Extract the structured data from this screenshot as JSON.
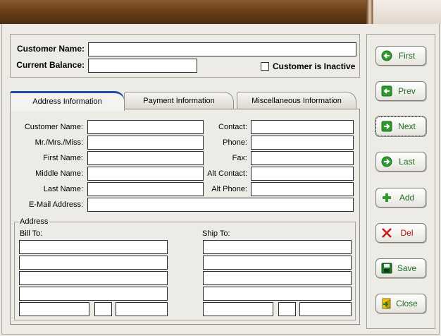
{
  "header": {
    "customer_name_label": "Customer Name:",
    "current_balance_label": "Current Balance:",
    "inactive_label": "Customer is Inactive",
    "customer_name_value": "",
    "current_balance_value": "",
    "inactive_checked": false
  },
  "tabs": [
    {
      "label": "Address Information",
      "active": true
    },
    {
      "label": "Payment Information",
      "active": false
    },
    {
      "label": "Miscellaneous Information",
      "active": false
    }
  ],
  "address_tab": {
    "left_labels": [
      "Customer Name:",
      "Mr./Mrs./Miss:",
      "First Name:",
      "Middle Name:",
      "Last Name:"
    ],
    "right_labels": [
      "Contact:",
      "Phone:",
      "Fax:",
      "Alt Contact:",
      "Alt Phone:"
    ],
    "email_label": "E-Mail Address:",
    "address_group_label": "Address",
    "bill_to_label": "Bill To:",
    "ship_to_label": "Ship To:"
  },
  "buttons": [
    {
      "label": "First",
      "icon": "arrow-left-circle-icon"
    },
    {
      "label": "Prev",
      "icon": "arrow-left-square-icon"
    },
    {
      "label": "Next",
      "icon": "arrow-right-square-icon"
    },
    {
      "label": "Last",
      "icon": "arrow-right-circle-icon"
    },
    {
      "label": "Add",
      "icon": "plus-icon"
    },
    {
      "label": "Del",
      "icon": "x-delete-icon"
    },
    {
      "label": "Save",
      "icon": "floppy-disk-icon"
    },
    {
      "label": "Close",
      "icon": "door-exit-icon"
    }
  ],
  "colors": {
    "accent": "#1e4fa0",
    "titlebar": "#6b3f1a",
    "icon_green": "#2e9b2e",
    "icon_red": "#c81414"
  }
}
